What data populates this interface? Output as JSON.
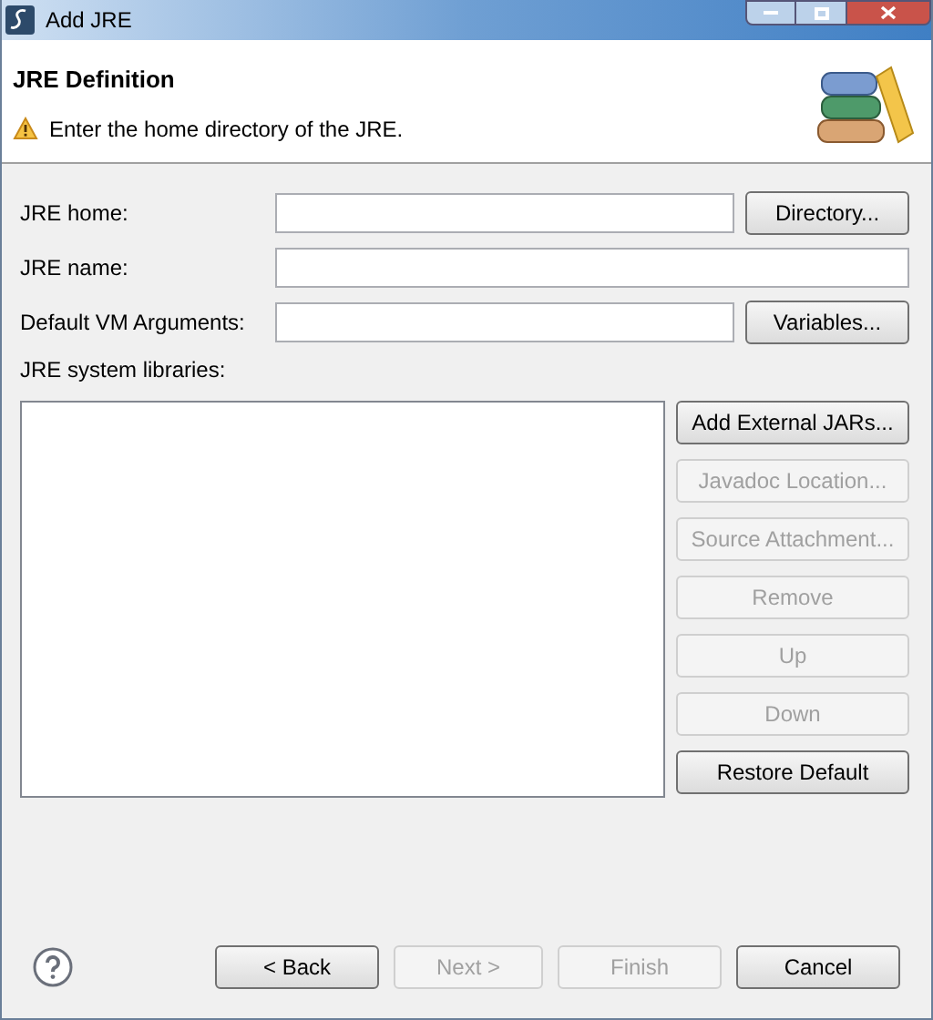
{
  "window": {
    "title": "Add JRE"
  },
  "header": {
    "title": "JRE Definition",
    "message": "Enter the home directory of the JRE."
  },
  "fields": [
    {
      "label": "JRE home:",
      "button": "Directory..."
    },
    {
      "label": "JRE name:"
    },
    {
      "label": "Default VM Arguments:",
      "button": "Variables..."
    }
  ],
  "libraries": {
    "label": "JRE system libraries:"
  },
  "library_buttons": [
    {
      "label": "Add External JARs...",
      "disabled": false
    },
    {
      "label": "Javadoc Location...",
      "disabled": true
    },
    {
      "label": "Source Attachment...",
      "disabled": true
    },
    {
      "label": "Remove",
      "disabled": true
    },
    {
      "label": "Up",
      "disabled": true
    },
    {
      "label": "Down",
      "disabled": true
    },
    {
      "label": "Restore Default",
      "disabled": false
    }
  ],
  "footer_buttons": [
    {
      "label": "< Back",
      "disabled": false
    },
    {
      "label": "Next >",
      "disabled": true
    },
    {
      "label": "Finish",
      "disabled": true
    },
    {
      "label": "Cancel",
      "disabled": false
    }
  ]
}
